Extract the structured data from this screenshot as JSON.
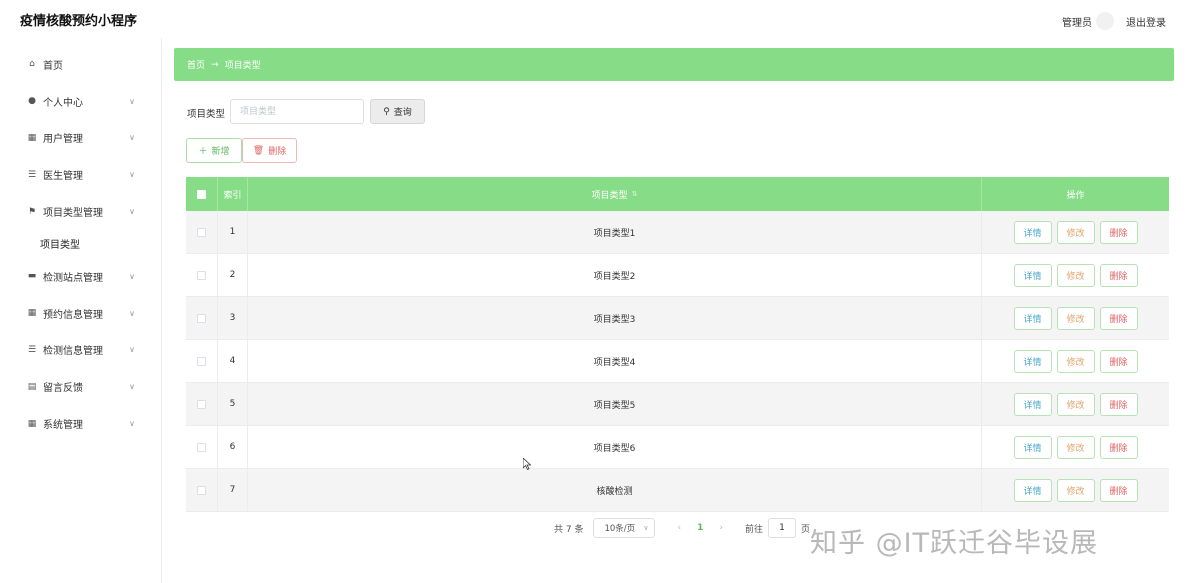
{
  "header": {
    "app_title": "疫情核酸预约小程序",
    "user_role": "管理员",
    "logout_label": "退出登录"
  },
  "sidebar": {
    "items": [
      {
        "label": "首页",
        "icon": "home-icon",
        "glyph": "⌂",
        "has_arrow": false
      },
      {
        "label": "个人中心",
        "icon": "user-icon",
        "glyph": "●",
        "has_arrow": true
      },
      {
        "label": "用户管理",
        "icon": "grid-icon",
        "glyph": "▦",
        "has_arrow": true
      },
      {
        "label": "医生管理",
        "icon": "list-icon",
        "glyph": "☰",
        "has_arrow": true
      },
      {
        "label": "项目类型管理",
        "icon": "flag-icon",
        "glyph": "⚑",
        "has_arrow": true
      }
    ],
    "sub_item": "项目类型",
    "items_after": [
      {
        "label": "检测站点管理",
        "icon": "chat-icon",
        "glyph": "▬",
        "has_arrow": true
      },
      {
        "label": "预约信息管理",
        "icon": "grid-icon",
        "glyph": "▦",
        "has_arrow": true
      },
      {
        "label": "检测信息管理",
        "icon": "sliders-icon",
        "glyph": "☰",
        "has_arrow": true
      },
      {
        "label": "留言反馈",
        "icon": "message-icon",
        "glyph": "▤",
        "has_arrow": true
      },
      {
        "label": "系统管理",
        "icon": "apps-icon",
        "glyph": "▦",
        "has_arrow": true
      }
    ]
  },
  "breadcrumb": {
    "home": "首页",
    "separator": "→",
    "current": "项目类型"
  },
  "filter": {
    "label": "项目类型",
    "placeholder": "项目类型",
    "query_label": "查询"
  },
  "toolbar": {
    "add_label": "新增",
    "delete_label": "删除"
  },
  "table": {
    "headers": {
      "index": "索引",
      "type": "项目类型",
      "operation": "操作"
    },
    "rows": [
      {
        "index": "1",
        "type": "项目类型1"
      },
      {
        "index": "2",
        "type": "项目类型2"
      },
      {
        "index": "3",
        "type": "项目类型3"
      },
      {
        "index": "4",
        "type": "项目类型4"
      },
      {
        "index": "5",
        "type": "项目类型5"
      },
      {
        "index": "6",
        "type": "项目类型6"
      },
      {
        "index": "7",
        "type": "核酸检测"
      }
    ],
    "actions": {
      "detail": "详情",
      "edit": "修改",
      "delete": "删除"
    }
  },
  "pagination": {
    "total_text": "共 7 条",
    "page_size": "10条/页",
    "current_page": "1",
    "goto_label": "前往",
    "goto_value": "1",
    "page_suffix": "页"
  },
  "watermark": "知乎 @IT跃迁谷毕设展",
  "colors": {
    "accent_green": "#87dc87",
    "text_dark": "#333333",
    "danger": "#e06464",
    "info": "#47a6c9",
    "warning": "#e0a46a"
  }
}
